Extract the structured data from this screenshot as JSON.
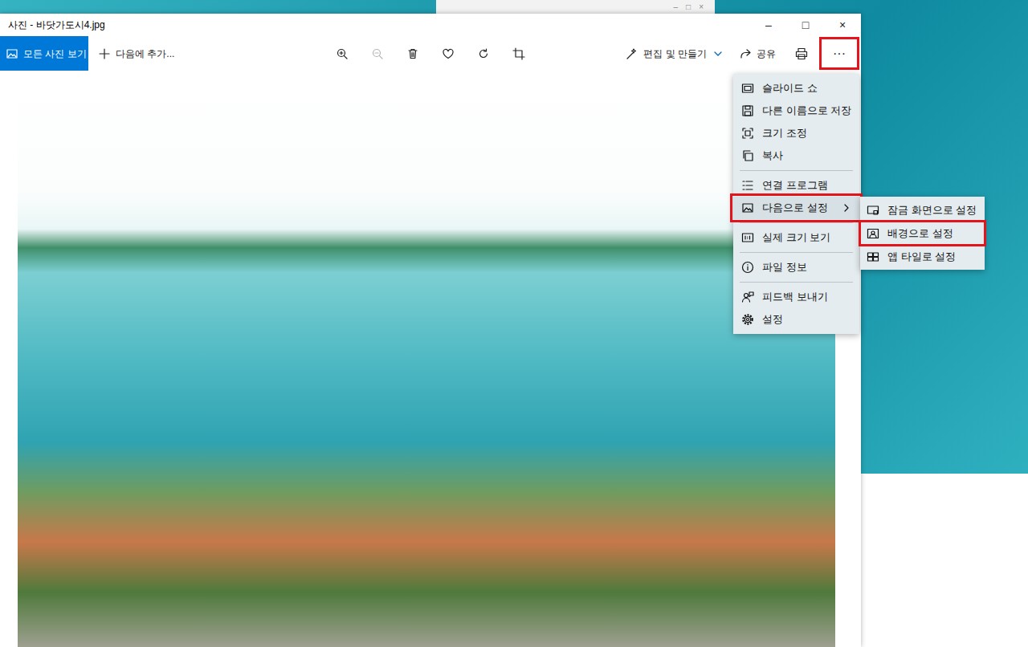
{
  "background_window": {
    "controls": [
      "–",
      "□",
      "×"
    ]
  },
  "window": {
    "title": "사진 - 바닷가도시4.jpg",
    "controls": [
      "–",
      "□",
      "×"
    ]
  },
  "toolbar": {
    "all_photos": {
      "label": "모든 사진 보기"
    },
    "add_to": {
      "label": "다음에 추가..."
    },
    "tools": [
      {
        "kind": "zoom-in",
        "disabled": false
      },
      {
        "kind": "zoom-out",
        "disabled": true
      },
      {
        "kind": "delete",
        "disabled": false
      },
      {
        "kind": "favorite",
        "disabled": false
      },
      {
        "kind": "rotate",
        "disabled": false
      },
      {
        "kind": "crop",
        "disabled": false
      }
    ],
    "edit": {
      "label": "편집 및 만들기"
    },
    "share": {
      "label": "공유"
    },
    "more": {
      "label": "···",
      "highlighted": true
    }
  },
  "menu": {
    "items": [
      {
        "label": "슬라이드 쇼",
        "kind": "slideshow",
        "has_submenu": false,
        "highlighted": false,
        "separator_after": false
      },
      {
        "label": "다른 이름으로 저장",
        "kind": "save",
        "has_submenu": false,
        "highlighted": false,
        "separator_after": false
      },
      {
        "label": "크기 조정",
        "kind": "resize",
        "has_submenu": false,
        "highlighted": false,
        "separator_after": false
      },
      {
        "label": "복사",
        "kind": "copy",
        "has_submenu": false,
        "highlighted": false,
        "separator_after": true
      },
      {
        "label": "연결 프로그램",
        "kind": "open-with",
        "has_submenu": false,
        "highlighted": false,
        "separator_after": false
      },
      {
        "label": "다음으로 설정",
        "kind": "set-as",
        "has_submenu": true,
        "highlighted": true,
        "separator_after": true
      },
      {
        "label": "실제 크기 보기",
        "kind": "actual-size",
        "has_submenu": false,
        "highlighted": false,
        "separator_after": true
      },
      {
        "label": "파일 정보",
        "kind": "info",
        "has_submenu": false,
        "highlighted": false,
        "separator_after": true
      },
      {
        "label": "피드백 보내기",
        "kind": "feedback",
        "has_submenu": false,
        "highlighted": false,
        "separator_after": false
      },
      {
        "label": "설정",
        "kind": "settings",
        "has_submenu": false,
        "highlighted": false,
        "separator_after": false
      }
    ]
  },
  "submenu": {
    "items": [
      {
        "label": "잠금 화면으로 설정",
        "kind": "lock-screen",
        "highlighted": false
      },
      {
        "label": "배경으로 설정",
        "kind": "background",
        "highlighted": true
      },
      {
        "label": "앱 타일로 설정",
        "kind": "tile",
        "highlighted": false
      }
    ]
  }
}
